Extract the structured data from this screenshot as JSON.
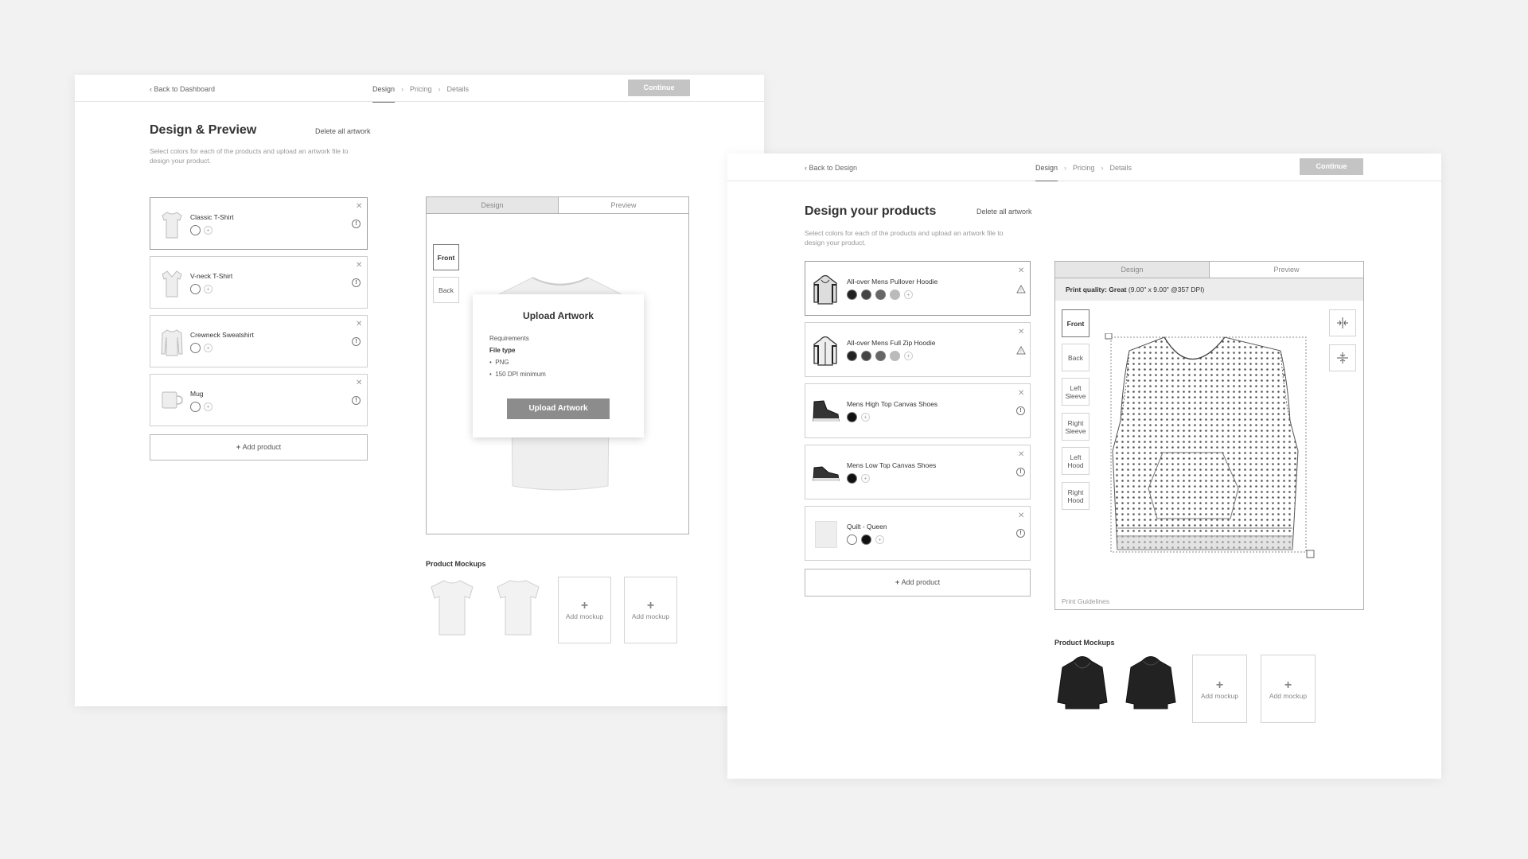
{
  "left": {
    "nav": {
      "back": "Back to Dashboard",
      "steps": [
        "Design",
        "Pricing",
        "Details"
      ],
      "continue": "Continue"
    },
    "title": "Design & Preview",
    "delete_all": "Delete all artwork",
    "subtitle": "Select colors for each of the products and upload an artwork file to design your product.",
    "products": [
      {
        "name": "Classic T-Shirt",
        "thumb": "tshirt-icon",
        "colors": [
          "#ffffff"
        ]
      },
      {
        "name": "V-neck T-Shirt",
        "thumb": "tshirt-icon",
        "colors": [
          "#ffffff"
        ]
      },
      {
        "name": "Crewneck Sweatshirt",
        "thumb": "sweatshirt-icon",
        "colors": [
          "#ffffff"
        ]
      },
      {
        "name": "Mug",
        "thumb": "mug-icon",
        "colors": [
          "#ffffff"
        ]
      }
    ],
    "add_product": "Add product",
    "tabs": [
      "Design",
      "Preview"
    ],
    "sides": [
      "Front",
      "Back"
    ],
    "modal": {
      "title": "Upload Artwork",
      "requirements": "Requirements",
      "file_type_label": "File type",
      "items": [
        "PNG",
        "150 DPI minimum"
      ],
      "button": "Upload Artwork"
    },
    "mockups_title": "Product Mockups",
    "add_mockup": "Add mockup"
  },
  "right": {
    "nav": {
      "back": "Back to Design",
      "steps": [
        "Design",
        "Pricing",
        "Details"
      ],
      "continue": "Continue"
    },
    "title": "Design your products",
    "delete_all": "Delete all artwork",
    "subtitle": "Select colors for each of the products and upload an artwork file to design your product.",
    "products": [
      {
        "name": "All-over Mens Pullover Hoodie",
        "thumb": "hoodie-icon",
        "status": "warning-icon",
        "colors": [
          "#222222",
          "#444444",
          "#666666",
          "#bbbbbb"
        ]
      },
      {
        "name": "All-over Mens Full Zip Hoodie",
        "thumb": "zip-hoodie-icon",
        "status": "warning-icon",
        "colors": [
          "#222222",
          "#444444",
          "#666666",
          "#bbbbbb"
        ]
      },
      {
        "name": "Mens High Top Canvas Shoes",
        "thumb": "shoe-icon",
        "status": "info-icon",
        "colors": [
          "#111111"
        ]
      },
      {
        "name": "Mens Low Top Canvas Shoes",
        "thumb": "shoe-icon",
        "status": "info-icon",
        "colors": [
          "#111111"
        ]
      },
      {
        "name": "Quilt - Queen",
        "thumb": "quilt-icon",
        "status": "info-icon",
        "colors": [
          "#ffffff",
          "#111111"
        ]
      }
    ],
    "add_product": "Add product",
    "tabs": [
      "Design",
      "Preview"
    ],
    "quality_label": "Print quality: Great",
    "quality_detail": "(9.00\" x 9.00\" @357 DPI)",
    "sides": [
      "Front",
      "Back",
      "Left Sleeve",
      "Right Sleeve",
      "Left Hood",
      "Right Hood"
    ],
    "print_guidelines": "Print Guidelines",
    "mockups_title": "Product Mockups",
    "add_mockup": "Add mockup"
  }
}
